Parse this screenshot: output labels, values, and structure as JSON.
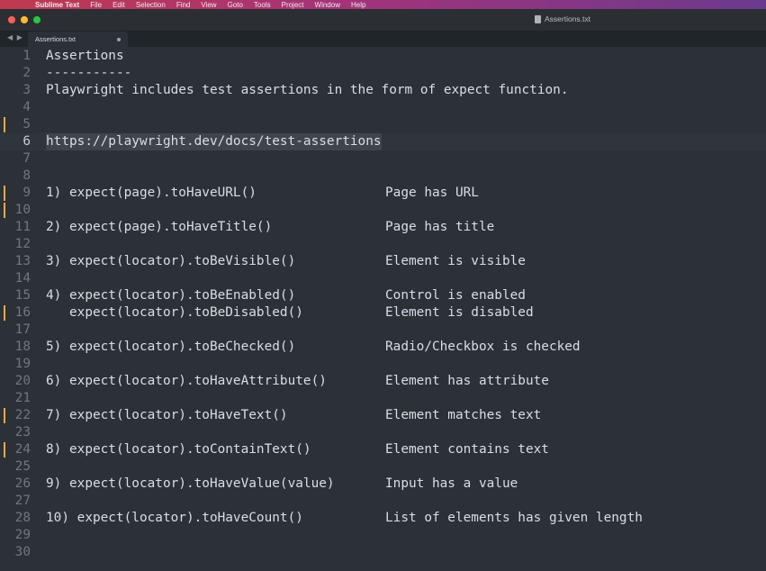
{
  "menubar": {
    "app_name": "Sublime Text",
    "items": [
      "File",
      "Edit",
      "Selection",
      "Find",
      "View",
      "Goto",
      "Tools",
      "Project",
      "Window",
      "Help"
    ]
  },
  "window": {
    "title": "Assertions.txt"
  },
  "tab": {
    "label": "Assertions.txt",
    "nav": "◀ ▶"
  },
  "lines": [
    {
      "n": "1",
      "code": "Assertions",
      "desc": ""
    },
    {
      "n": "2",
      "code": "-----------",
      "desc": ""
    },
    {
      "n": "3",
      "code": "Playwright includes test assertions in the form of expect function.",
      "desc": ""
    },
    {
      "n": "4",
      "code": "",
      "desc": ""
    },
    {
      "n": "5",
      "code": "",
      "desc": ""
    },
    {
      "n": "6",
      "code": "https://playwright.dev/docs/test-assertions",
      "desc": ""
    },
    {
      "n": "7",
      "code": "",
      "desc": ""
    },
    {
      "n": "8",
      "code": "",
      "desc": ""
    },
    {
      "n": "9",
      "code": "1) expect(page).toHaveURL()",
      "desc": "Page has URL"
    },
    {
      "n": "10",
      "code": "",
      "desc": ""
    },
    {
      "n": "11",
      "code": "2) expect(page).toHaveTitle()",
      "desc": "Page has title"
    },
    {
      "n": "12",
      "code": "",
      "desc": ""
    },
    {
      "n": "13",
      "code": "3) expect(locator).toBeVisible()",
      "desc": "Element is visible"
    },
    {
      "n": "14",
      "code": "",
      "desc": ""
    },
    {
      "n": "15",
      "code": "4) expect(locator).toBeEnabled()",
      "desc": "Control is enabled"
    },
    {
      "n": "16",
      "code": "   expect(locator).toBeDisabled()",
      "desc": "Element is disabled"
    },
    {
      "n": "17",
      "code": "",
      "desc": ""
    },
    {
      "n": "18",
      "code": "5) expect(locator).toBeChecked()",
      "desc": "Radio/Checkbox is checked"
    },
    {
      "n": "19",
      "code": "",
      "desc": ""
    },
    {
      "n": "20",
      "code": "6) expect(locator).toHaveAttribute()",
      "desc": "Element has attribute"
    },
    {
      "n": "21",
      "code": "",
      "desc": ""
    },
    {
      "n": "22",
      "code": "7) expect(locator).toHaveText()",
      "desc": "Element matches text"
    },
    {
      "n": "23",
      "code": "",
      "desc": ""
    },
    {
      "n": "24",
      "code": "8) expect(locator).toContainText()",
      "desc": "Element contains text"
    },
    {
      "n": "25",
      "code": "",
      "desc": ""
    },
    {
      "n": "26",
      "code": "9) expect(locator).toHaveValue(value)",
      "desc": "Input has a value"
    },
    {
      "n": "27",
      "code": "",
      "desc": ""
    },
    {
      "n": "28",
      "code": "10) expect(locator).toHaveCount()",
      "desc": "List of elements has given length"
    },
    {
      "n": "29",
      "code": "",
      "desc": ""
    },
    {
      "n": "30",
      "code": "",
      "desc": ""
    }
  ],
  "colors": {
    "modified_marker": "#f2a93b",
    "editor_bg": "#2b3137",
    "text": "#d8dee9",
    "gutter": "#6e7880"
  }
}
